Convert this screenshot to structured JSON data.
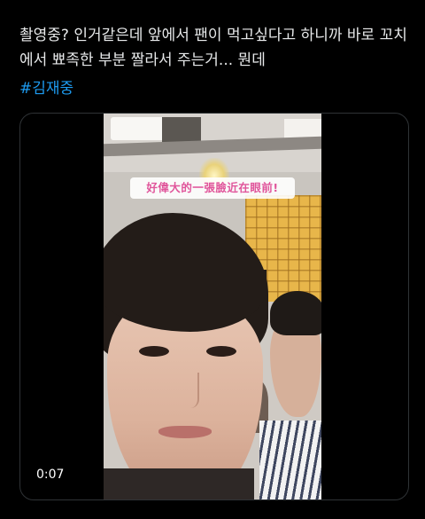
{
  "tweet": {
    "text": "촬영중? 인거같은데 앞에서 팬이 먹고싶다고 하니까 바로 꼬치에서 뾰족한 부분 짤라서 주는거... 뭔데",
    "hashtag": "#김재중"
  },
  "video": {
    "caption_sticker": "好偉大的一張臉近在眼前!",
    "timestamp": "0:07"
  }
}
